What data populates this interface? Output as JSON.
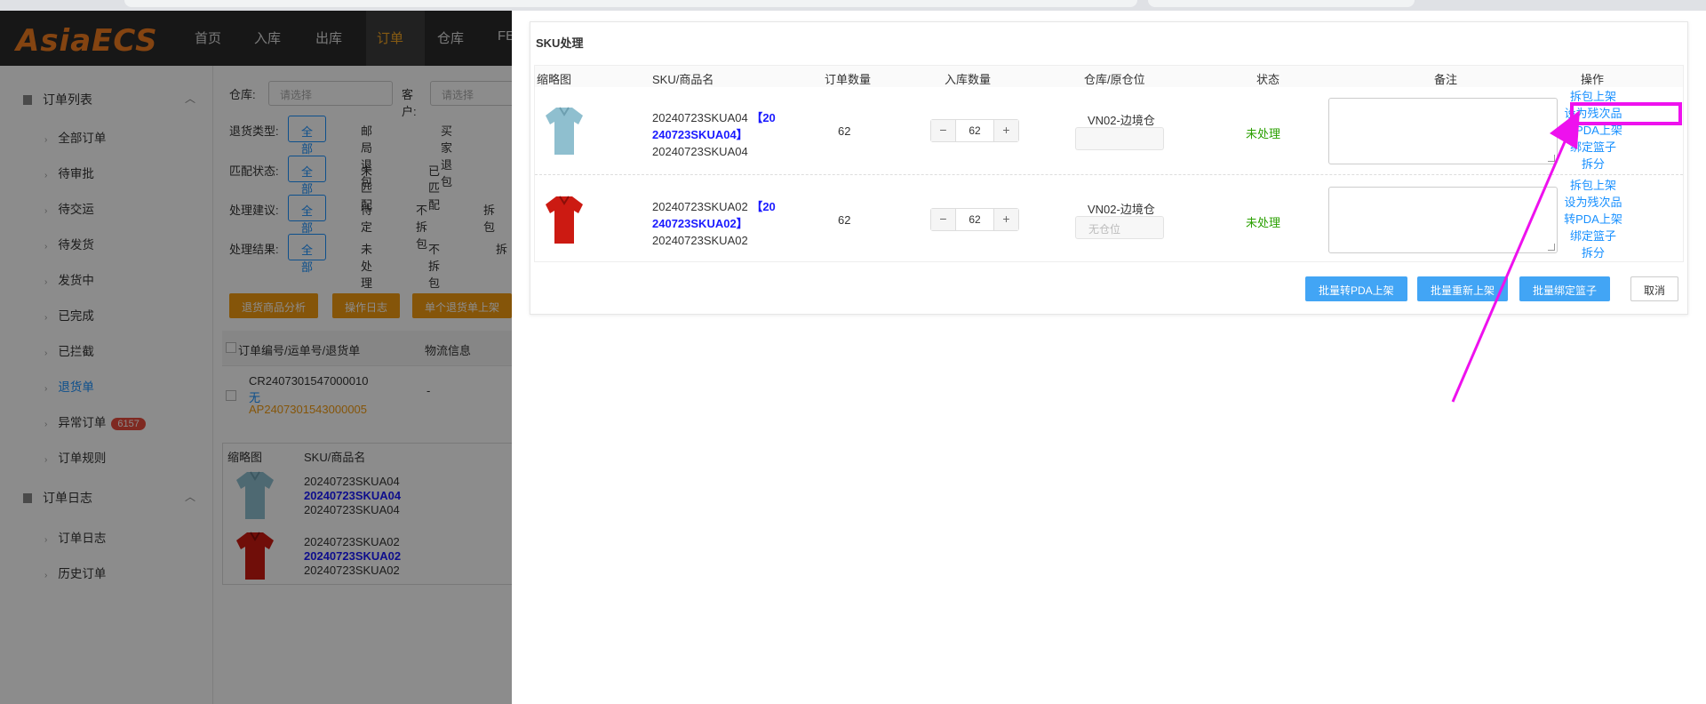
{
  "app": {
    "logo": "AsiaECS",
    "nav": [
      "首页",
      "入库",
      "出库",
      "订单",
      "仓库",
      "FE"
    ],
    "nav_active": "订单"
  },
  "sidebar": {
    "group1": "订单列表",
    "items": [
      "全部订单",
      "待审批",
      "待交运",
      "待发货",
      "发货中",
      "已完成",
      "已拦截",
      "退货单",
      "异常订单",
      "订单规则"
    ],
    "active_item": "退货单",
    "abnormal_badge": "6157",
    "group2": "订单日志",
    "items2": [
      "订单日志",
      "历史订单"
    ]
  },
  "filters": {
    "warehouse_label": "仓库:",
    "warehouse_placeholder": "请选择",
    "customer_label": "客户:",
    "customer_placeholder": "请选择",
    "return_type_label": "退货类型:",
    "return_type_options": [
      "全部",
      "邮局退包",
      "买家退包"
    ],
    "match_label": "匹配状态:",
    "match_options": [
      "全部",
      "未匹配",
      "已匹配"
    ],
    "suggest_label": "处理建议:",
    "suggest_options": [
      "全部",
      "待定",
      "不拆包",
      "拆包"
    ],
    "result_label": "处理结果:",
    "result_options": [
      "全部",
      "未处理",
      "不拆包",
      "拆"
    ]
  },
  "actions": [
    "退货商品分析",
    "操作日志",
    "单个退货单上架"
  ],
  "order_table": {
    "col1": "订单编号/运单号/退货单",
    "col2": "物流信息",
    "order_no": "CR2407301547000010",
    "waybill": "无",
    "return_no": "AP2407301543000005",
    "logistics": "-",
    "sub_head_thumb": "缩略图",
    "sub_head_sku": "SKU/商品名",
    "sub_rows": [
      {
        "code": "20240723SKUA04",
        "link": "20240723SKUA04",
        "name": "20240723SKUA04"
      },
      {
        "code": "20240723SKUA02",
        "link": "20240723SKUA02",
        "name": "20240723SKUA02"
      }
    ]
  },
  "modal": {
    "title": "SKU处理",
    "headers": {
      "thumb": "缩略图",
      "sku": "SKU/商品名",
      "order_qty": "订单数量",
      "in_qty": "入库数量",
      "location": "仓库/原仓位",
      "status": "状态",
      "remark": "备注",
      "ops": "操作"
    },
    "rows": [
      {
        "sku_code": "20240723SKUA04",
        "sku_link_a": "【20",
        "sku_link_b": "240723SKUA04】",
        "sku_name": "20240723SKUA04",
        "order_qty": "62",
        "in_qty": "62",
        "warehouse": "VN02-边境仓",
        "location_placeholder": "",
        "status": "未处理",
        "ops": [
          "拆包上架",
          "设为残次品",
          "转PDA上架",
          "绑定篮子",
          "拆分"
        ]
      },
      {
        "sku_code": "20240723SKUA02",
        "sku_link_a": "【20",
        "sku_link_b": "240723SKUA02】",
        "sku_name": "20240723SKUA02",
        "order_qty": "62",
        "in_qty": "62",
        "warehouse": "VN02-边境仓",
        "location_placeholder": "无仓位",
        "status": "未处理",
        "ops": [
          "拆包上架",
          "设为残次品",
          "转PDA上架",
          "绑定篮子",
          "拆分"
        ]
      }
    ],
    "buttons": {
      "batch_pda": "批量转PDA上架",
      "batch_reshelve": "批量重新上架",
      "batch_basket": "批量绑定篮子",
      "cancel": "取消"
    }
  },
  "colors": {
    "accent": "#1890ff",
    "orange": "#f39c12",
    "status_green": "#2aa000",
    "highlight": "#ee11ee",
    "shirt_blue": "#8fbfcf",
    "shirt_red": "#cc1a12"
  }
}
